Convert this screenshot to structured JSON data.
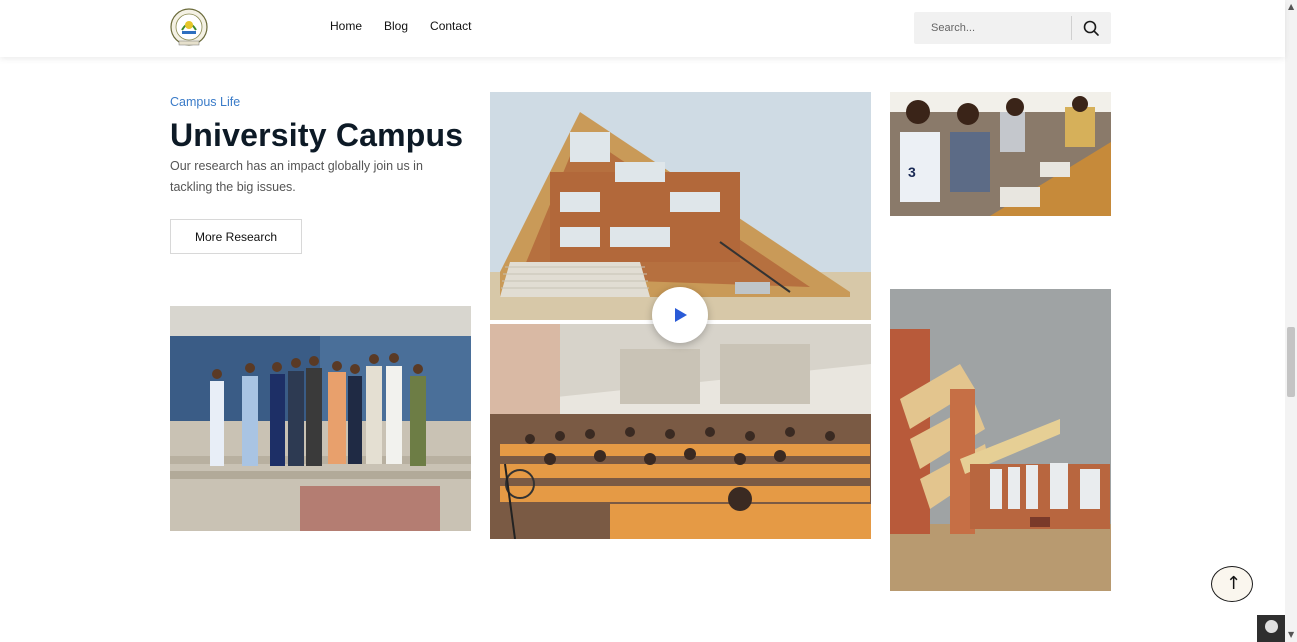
{
  "header": {
    "logo_alt": "University logo",
    "nav": [
      {
        "label": "Home"
      },
      {
        "label": "Blog"
      },
      {
        "label": "Contact"
      }
    ],
    "search": {
      "placeholder": "Search...",
      "icon": "search-icon"
    }
  },
  "hero": {
    "eyebrow": "Campus Life",
    "title": "University Campus",
    "description": "Our research has an impact globally join us in tackling the big issues.",
    "button_label": "More Research"
  },
  "gallery": {
    "photos": [
      {
        "name": "group-photo",
        "alt": "Group of people standing in front of a building"
      },
      {
        "name": "campus-building-photo",
        "alt": "Campus building with slanted roof"
      },
      {
        "name": "lecture-hall-photo",
        "alt": "Lecture hall full of students"
      },
      {
        "name": "classroom-photo",
        "alt": "Students writing in a classroom"
      },
      {
        "name": "stairs-building-photo",
        "alt": "Building with exterior staircase"
      }
    ],
    "play_icon": "play-icon"
  },
  "controls": {
    "scroll_top_icon": "arrow-up-icon",
    "scroll_top_glyph": "↑",
    "scroll_up_glyph": "▲",
    "scroll_down_glyph": "▼"
  },
  "colors": {
    "accent": "#3a7bc8",
    "title": "#0d1a26",
    "play": "#2a5bd7"
  }
}
